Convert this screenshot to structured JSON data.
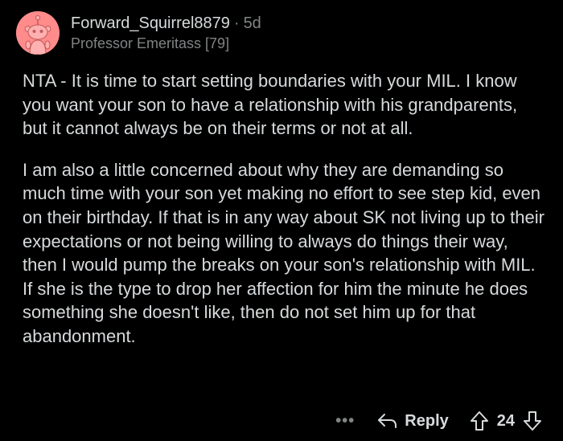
{
  "comment": {
    "username": "Forward_Squirrel8879",
    "separator": "·",
    "age": "5d",
    "flair": "Professor Emeritass [79]",
    "paragraphs": [
      "NTA - It is time to start setting boundaries with your MIL. I know you want your son to have a relationship with his grandparents, but it cannot always be on their terms or not at all.",
      "I am also a little concerned about why they are demanding so much time with your son yet making no effort to see step kid, even on their birthday. If that is in any way about SK not living up to their expectations or not being willing to always do things their way, then I would pump the breaks on your son's relationship with MIL. If she is the type to drop her affection for him the minute he does something she doesn't like, then do not set him up for that abandonment."
    ]
  },
  "actions": {
    "more_label": "•••",
    "reply_label": "Reply",
    "score": "24"
  },
  "icons": {
    "avatar": "snoo-avatar-icon",
    "reply": "reply-arrow-icon",
    "upvote": "upvote-arrow-icon",
    "downvote": "downvote-arrow-icon",
    "more": "more-options-icon"
  },
  "colors": {
    "background": "#000000",
    "text": "#d7dadc",
    "muted": "#818384",
    "avatar_bg": "#ff8b8b"
  }
}
